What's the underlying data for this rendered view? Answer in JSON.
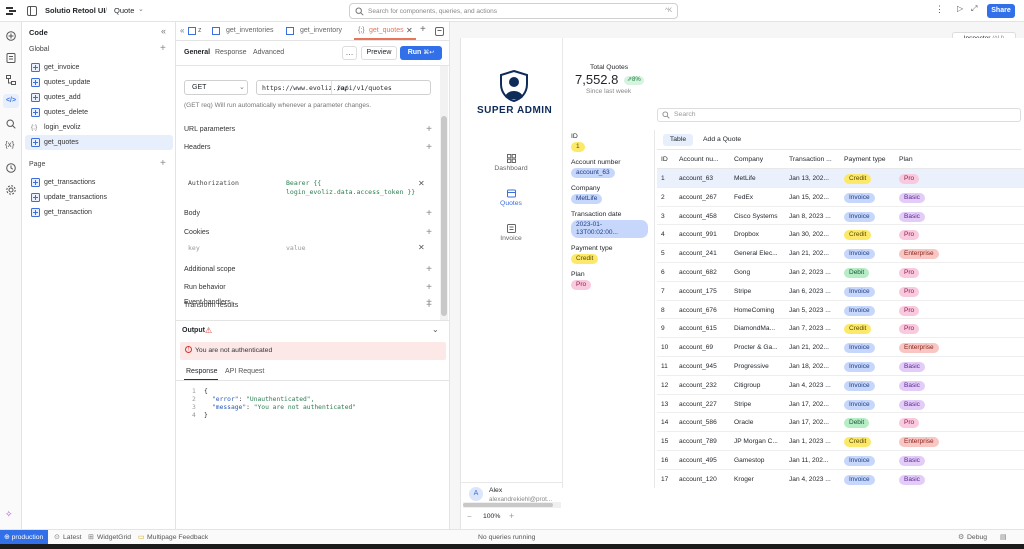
{
  "topbar": {
    "app_name": "Solutio Retool UI",
    "separator": "/",
    "page_name": "Quote",
    "search_placeholder": "Search for components, queries, and actions",
    "search_shortcut": "^K",
    "share_label": "Share"
  },
  "left_panel": {
    "title": "Code",
    "global_label": "Global",
    "global_items": [
      {
        "label": "get_invoice",
        "type": "query"
      },
      {
        "label": "quotes_update",
        "type": "query"
      },
      {
        "label": "quotes_add",
        "type": "query"
      },
      {
        "label": "quotes_delete",
        "type": "query"
      },
      {
        "label": "login_evoliz",
        "type": "js"
      },
      {
        "label": "get_quotes",
        "type": "query",
        "selected": true
      }
    ],
    "page_label": "Page",
    "page_items": [
      {
        "label": "get_transactions"
      },
      {
        "label": "update_transactions"
      },
      {
        "label": "get_transaction"
      }
    ]
  },
  "editor": {
    "tabs": [
      {
        "label": "z"
      },
      {
        "label": "get_inventories"
      },
      {
        "label": "get_inventory"
      },
      {
        "label": "get_quotes",
        "active": true
      }
    ],
    "subtabs": [
      "General",
      "Response",
      "Advanced"
    ],
    "preview_label": "Preview",
    "run_label": "Run",
    "run_shortcut": "⌘↩",
    "method": "GET",
    "base_url": "https://www.evoliz.io/",
    "path": "/api/v1/quotes",
    "hint": "(GET req) Will run automatically whenever a parameter changes.",
    "sections": {
      "url_params": "URL parameters",
      "headers": "Headers",
      "body": "Body",
      "cookies": "Cookies",
      "additional_scope": "Additional scope",
      "run_behavior": "Run behavior",
      "transform": "Transform results",
      "event_handlers": "Event handlers"
    },
    "header_key": "Authorization",
    "header_value_line1": "Bearer {{",
    "header_value_line2": "login_evoliz.data.access_token }}",
    "cookie_key_placeholder": "key",
    "cookie_value_placeholder": "value"
  },
  "output": {
    "title": "Output",
    "error": "You are not authenticated",
    "tabs": [
      "Response",
      "API Request"
    ],
    "code_lines": [
      {
        "n": "1",
        "text": "{"
      },
      {
        "n": "2",
        "key": "\"error\"",
        "value": "\"Unauthenticated\","
      },
      {
        "n": "3",
        "key": "\"message\"",
        "value": "\"You are not authenticated\""
      },
      {
        "n": "4",
        "text": "}"
      }
    ]
  },
  "canvas": {
    "inspector_label": "Inspector",
    "inspector_shortcut": "(^U)",
    "logo_line1": "SUPER",
    "logo_line2": "ADMIN",
    "nav": [
      {
        "label": "Dashboard"
      },
      {
        "label": "Quotes",
        "active": true
      },
      {
        "label": "Invoice"
      }
    ],
    "user_name": "Alex",
    "user_email": "alexandrekiehl@prot...",
    "user_initial": "A",
    "zoom": "100%",
    "stat": {
      "label": "Total Quotes",
      "value": "7,552.8",
      "change": "8%",
      "caption": "Since last week"
    },
    "search_placeholder": "Search",
    "detail": [
      {
        "label": "ID",
        "value": "1",
        "chip": "credit"
      },
      {
        "label": "Account number",
        "value": "account_63",
        "chip": "invoice"
      },
      {
        "label": "Company",
        "value": "MetLife",
        "chip": "invoice"
      },
      {
        "label": "Transaction date",
        "value": "2023-01-13T00:02:00...",
        "chip": "invoice"
      },
      {
        "label": "Payment type",
        "value": "Credit",
        "chip": "credit"
      },
      {
        "label": "Plan",
        "value": "Pro",
        "chip": "pro"
      }
    ],
    "table_tabs": [
      "Table",
      "Add a Quote"
    ],
    "columns": [
      "ID",
      "Account nu...",
      "Company",
      "Transaction ...",
      "Payment type",
      "Plan"
    ],
    "rows": [
      {
        "id": "1",
        "account": "account_63",
        "company": "MetLife",
        "date": "Jan 13, 202...",
        "payment": "Credit",
        "plan": "Pro"
      },
      {
        "id": "2",
        "account": "account_267",
        "company": "FedEx",
        "date": "Jan 15, 202...",
        "payment": "Invoice",
        "plan": "Basic"
      },
      {
        "id": "3",
        "account": "account_458",
        "company": "Cisco Systems",
        "date": "Jan 8, 2023 ...",
        "payment": "Invoice",
        "plan": "Basic"
      },
      {
        "id": "4",
        "account": "account_991",
        "company": "Dropbox",
        "date": "Jan 30, 202...",
        "payment": "Credit",
        "plan": "Pro"
      },
      {
        "id": "5",
        "account": "account_241",
        "company": "General Elec...",
        "date": "Jan 21, 202...",
        "payment": "Invoice",
        "plan": "Enterprise"
      },
      {
        "id": "6",
        "account": "account_682",
        "company": "Gong",
        "date": "Jan 2, 2023 ...",
        "payment": "Debit",
        "plan": "Pro"
      },
      {
        "id": "7",
        "account": "account_175",
        "company": "Stripe",
        "date": "Jan 6, 2023 ...",
        "payment": "Invoice",
        "plan": "Pro"
      },
      {
        "id": "8",
        "account": "account_676",
        "company": "HomeComing",
        "date": "Jan 5, 2023 ...",
        "payment": "Invoice",
        "plan": "Pro"
      },
      {
        "id": "9",
        "account": "account_615",
        "company": "DiamondMa...",
        "date": "Jan 7, 2023 ...",
        "payment": "Credit",
        "plan": "Pro"
      },
      {
        "id": "10",
        "account": "account_69",
        "company": "Procter & Ga...",
        "date": "Jan 21, 202...",
        "payment": "Invoice",
        "plan": "Enterprise"
      },
      {
        "id": "11",
        "account": "account_945",
        "company": "Progressive",
        "date": "Jan 18, 202...",
        "payment": "Invoice",
        "plan": "Basic"
      },
      {
        "id": "12",
        "account": "account_232",
        "company": "Citigroup",
        "date": "Jan 4, 2023 ...",
        "payment": "Invoice",
        "plan": "Basic"
      },
      {
        "id": "13",
        "account": "account_227",
        "company": "Stripe",
        "date": "Jan 17, 202...",
        "payment": "Invoice",
        "plan": "Basic"
      },
      {
        "id": "14",
        "account": "account_586",
        "company": "Oracle",
        "date": "Jan 17, 202...",
        "payment": "Debit",
        "plan": "Pro"
      },
      {
        "id": "15",
        "account": "account_789",
        "company": "JP Morgan C...",
        "date": "Jan 1, 2023 ...",
        "payment": "Credit",
        "plan": "Enterprise"
      },
      {
        "id": "16",
        "account": "account_495",
        "company": "Gamestop",
        "date": "Jan 11, 202...",
        "payment": "Invoice",
        "plan": "Basic"
      },
      {
        "id": "17",
        "account": "account_120",
        "company": "Kroger",
        "date": "Jan 4, 2023 ...",
        "payment": "Invoice",
        "plan": "Basic"
      }
    ]
  },
  "statusbar": {
    "env": "production",
    "latest": "Latest",
    "widget": "WidgetGrid",
    "feedback": "Multipage Feedback",
    "queries": "No queries running",
    "debug": "Debug"
  },
  "colors": {
    "accent": "#3b6fe0",
    "run_button": "#3170e8",
    "error_bg": "#fde8e8",
    "selected_row": "#eaf1fd"
  }
}
